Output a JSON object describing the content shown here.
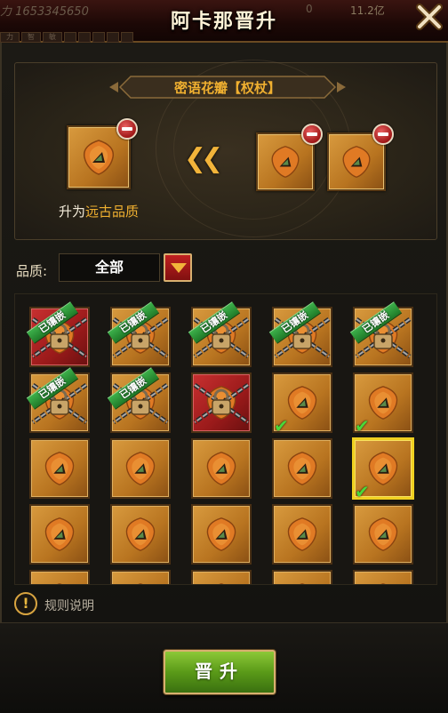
{
  "header": {
    "title": "阿卡那晋升",
    "bg_power": "力 1653345650",
    "bg_count": "0",
    "bg_gold": "11.2亿",
    "bg_tabs": [
      "力",
      "智",
      "敏",
      "",
      "",
      "",
      "",
      ""
    ]
  },
  "item": {
    "name": "密语花瓣【权杖】",
    "upgrade_prefix": "升为",
    "upgrade_quality": "远古品质"
  },
  "filter": {
    "label": "品质:",
    "selected": "全部"
  },
  "grid": {
    "embedded_label": "已镶嵌",
    "rows": [
      [
        {
          "bg": "red",
          "locked": true,
          "embedded": true
        },
        {
          "bg": "gold",
          "locked": true,
          "embedded": true
        },
        {
          "bg": "gold",
          "locked": true,
          "embedded": true
        },
        {
          "bg": "gold",
          "locked": true,
          "embedded": true
        },
        {
          "bg": "gold",
          "locked": true,
          "embedded": true
        }
      ],
      [
        {
          "bg": "gold",
          "locked": true,
          "embedded": true
        },
        {
          "bg": "gold",
          "locked": true,
          "embedded": true
        },
        {
          "bg": "red",
          "locked": true,
          "embedded": false
        },
        {
          "bg": "gold",
          "checked": true
        },
        {
          "bg": "gold",
          "checked": true
        }
      ],
      [
        {
          "bg": "gold"
        },
        {
          "bg": "gold"
        },
        {
          "bg": "gold"
        },
        {
          "bg": "gold"
        },
        {
          "bg": "gold",
          "checked": true,
          "selected": true
        }
      ],
      [
        {
          "bg": "gold"
        },
        {
          "bg": "gold"
        },
        {
          "bg": "gold"
        },
        {
          "bg": "gold"
        },
        {
          "bg": "gold"
        }
      ],
      [
        {
          "bg": "gold"
        },
        {
          "bg": "gold"
        },
        {
          "bg": "gold"
        },
        {
          "bg": "gold"
        },
        {
          "bg": "gold"
        }
      ]
    ]
  },
  "help": {
    "label": "规则说明"
  },
  "actions": {
    "promote_label": "晋升"
  },
  "colors": {
    "gold_text": "#f0b030",
    "button_green": "#5a9a18",
    "embedded_green": "#2e9a38"
  }
}
